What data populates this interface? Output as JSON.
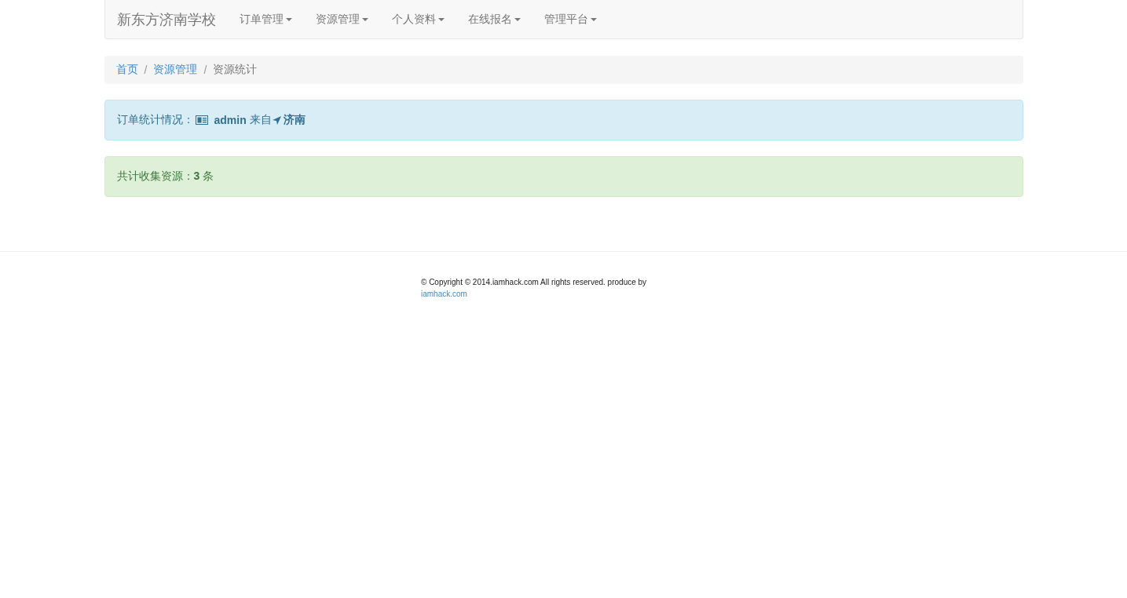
{
  "navbar": {
    "brand": "新东方济南学校",
    "items": [
      {
        "label": "订单管理"
      },
      {
        "label": "资源管理"
      },
      {
        "label": "个人资料"
      },
      {
        "label": "在线报名"
      },
      {
        "label": "管理平台"
      }
    ]
  },
  "breadcrumb": {
    "separator": "/",
    "items": [
      {
        "label": "首页",
        "kind": "link"
      },
      {
        "label": "资源管理",
        "kind": "link"
      },
      {
        "label": "资源统计",
        "kind": "current"
      }
    ]
  },
  "info_alert": {
    "label": "订单统计情况：",
    "user": "admin",
    "from": "来自",
    "city": "济南"
  },
  "success_alert": {
    "text": "共计收集资源：**3** 条"
  },
  "footer": {
    "copyright": "© Copyright © 2014.iamhack.com All rights reserved. produce by",
    "link": "iamhack.com"
  }
}
